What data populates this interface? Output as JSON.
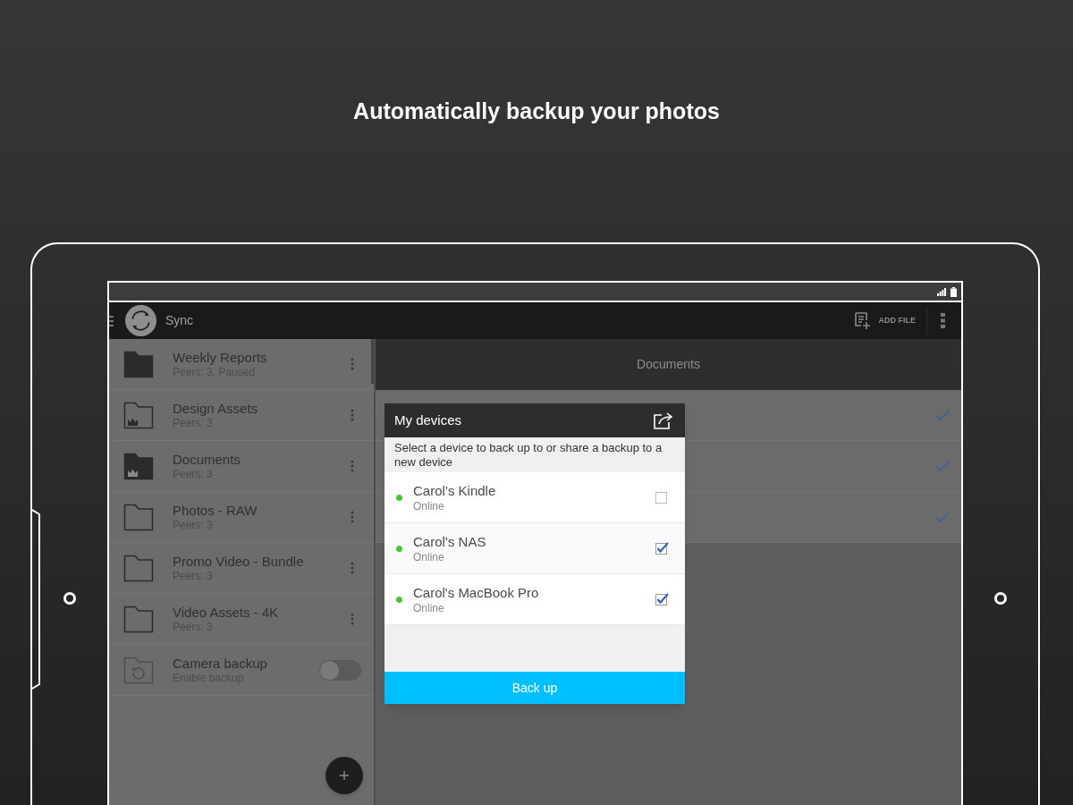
{
  "headline": "Automatically backup your photos",
  "app_bar": {
    "title": "Sync",
    "action": "ADD FILE"
  },
  "sidebar": {
    "folders": [
      {
        "name": "Weekly Reports",
        "detail": "Peers: 3, Paused",
        "kind": "folder-filled"
      },
      {
        "name": "Design Assets",
        "detail": "Peers: 3",
        "kind": "folder-crown-outline"
      },
      {
        "name": "Documents",
        "detail": "Peers: 3",
        "kind": "folder-crown-filled"
      },
      {
        "name": "Photos - RAW",
        "detail": "Peers: 3",
        "kind": "folder-outline"
      },
      {
        "name": "Promo Video - Bundle",
        "detail": "Peers: 3",
        "kind": "folder-outline"
      },
      {
        "name": "Video Assets - 4K",
        "detail": "Peers: 3",
        "kind": "folder-outline"
      }
    ],
    "camera_backup": {
      "title": "Camera backup",
      "detail": "Enable backup",
      "on": false
    }
  },
  "content": {
    "title": "Documents",
    "rows": [
      {
        "synced": true
      },
      {
        "synced": true
      },
      {
        "synced": true
      }
    ]
  },
  "dialog": {
    "title": "My devices",
    "message": "Select a device to back up to or share a backup to a new device",
    "devices": [
      {
        "name": "Carol’s Kindle",
        "status": "Online",
        "color": "#4cc53a",
        "checked": false
      },
      {
        "name": "Carol’s NAS",
        "status": "Online",
        "color": "#4cc53a",
        "checked": true
      },
      {
        "name": "Carol's MacBook Pro",
        "status": "Online",
        "color": "#4cc53a",
        "checked": true
      }
    ],
    "button": "Back up"
  }
}
